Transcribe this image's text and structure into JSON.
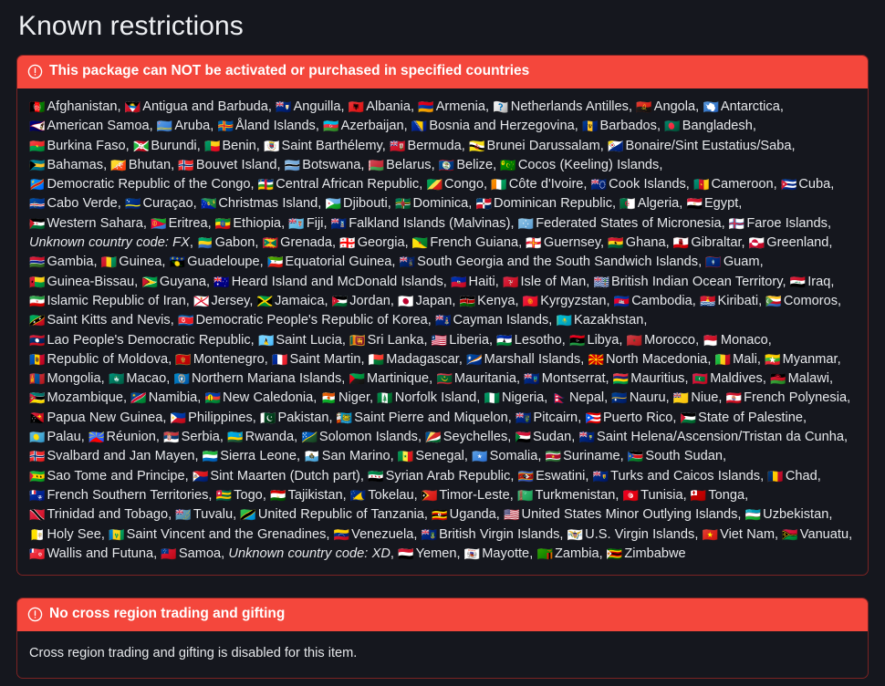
{
  "page": {
    "title": "Known restrictions",
    "background_color": "#15171e",
    "accent_color": "#f4473c",
    "border_color": "#7b2323",
    "text_color": "#e6e8eb"
  },
  "panels": [
    {
      "id": "country-restrictions",
      "icon": "exclamation-circle-icon",
      "header": "This package can NOT be activated or purchased in specified countries",
      "separator": ", ",
      "countries": [
        {
          "flag": "🇦🇫",
          "name": "Afghanistan"
        },
        {
          "flag": "🇦🇬",
          "name": "Antigua and Barbuda"
        },
        {
          "flag": "🇦🇮",
          "name": "Anguilla"
        },
        {
          "flag": "🇦🇱",
          "name": "Albania"
        },
        {
          "flag": "🇦🇲",
          "name": "Armenia"
        },
        {
          "flag": "🇦🇳",
          "name": "Netherlands Antilles"
        },
        {
          "flag": "🇦🇴",
          "name": "Angola"
        },
        {
          "flag": "🇦🇶",
          "name": "Antarctica"
        },
        {
          "flag": "🇦🇸",
          "name": "American Samoa"
        },
        {
          "flag": "🇦🇼",
          "name": "Aruba"
        },
        {
          "flag": "🇦🇽",
          "name": "Åland Islands"
        },
        {
          "flag": "🇦🇿",
          "name": "Azerbaijan"
        },
        {
          "flag": "🇧🇦",
          "name": "Bosnia and Herzegovina"
        },
        {
          "flag": "🇧🇧",
          "name": "Barbados"
        },
        {
          "flag": "🇧🇩",
          "name": "Bangladesh"
        },
        {
          "flag": "🇧🇫",
          "name": "Burkina Faso"
        },
        {
          "flag": "🇧🇮",
          "name": "Burundi"
        },
        {
          "flag": "🇧🇯",
          "name": "Benin"
        },
        {
          "flag": "🇧🇱",
          "name": "Saint Barthélemy"
        },
        {
          "flag": "🇧🇲",
          "name": "Bermuda"
        },
        {
          "flag": "🇧🇳",
          "name": "Brunei Darussalam"
        },
        {
          "flag": "🇧🇶",
          "name": "Bonaire/Sint Eustatius/Saba"
        },
        {
          "flag": "🇧🇸",
          "name": "Bahamas"
        },
        {
          "flag": "🇧🇹",
          "name": "Bhutan"
        },
        {
          "flag": "🇧🇻",
          "name": "Bouvet Island"
        },
        {
          "flag": "🇧🇼",
          "name": "Botswana"
        },
        {
          "flag": "🇧🇾",
          "name": "Belarus"
        },
        {
          "flag": "🇧🇿",
          "name": "Belize"
        },
        {
          "flag": "🇨🇨",
          "name": "Cocos (Keeling) Islands"
        },
        {
          "flag": "🇨🇩",
          "name": "Democratic Republic of the Congo"
        },
        {
          "flag": "🇨🇫",
          "name": "Central African Republic"
        },
        {
          "flag": "🇨🇬",
          "name": "Congo"
        },
        {
          "flag": "🇨🇮",
          "name": "Côte d'Ivoire"
        },
        {
          "flag": "🇨🇰",
          "name": "Cook Islands"
        },
        {
          "flag": "🇨🇲",
          "name": "Cameroon"
        },
        {
          "flag": "🇨🇺",
          "name": "Cuba"
        },
        {
          "flag": "🇨🇻",
          "name": "Cabo Verde"
        },
        {
          "flag": "🇨🇼",
          "name": "Curaçao"
        },
        {
          "flag": "🇨🇽",
          "name": "Christmas Island"
        },
        {
          "flag": "🇩🇯",
          "name": "Djibouti"
        },
        {
          "flag": "🇩🇲",
          "name": "Dominica"
        },
        {
          "flag": "🇩🇴",
          "name": "Dominican Republic"
        },
        {
          "flag": "🇩🇿",
          "name": "Algeria"
        },
        {
          "flag": "🇪🇬",
          "name": "Egypt"
        },
        {
          "flag": "🇪🇭",
          "name": "Western Sahara"
        },
        {
          "flag": "🇪🇷",
          "name": "Eritrea"
        },
        {
          "flag": "🇪🇹",
          "name": "Ethiopia"
        },
        {
          "flag": "🇫🇯",
          "name": "Fiji"
        },
        {
          "flag": "🇫🇰",
          "name": "Falkland Islands (Malvinas)"
        },
        {
          "flag": "🇫🇲",
          "name": "Federated States of Micronesia"
        },
        {
          "flag": "🇫🇴",
          "name": "Faroe Islands"
        },
        {
          "flag": "",
          "name": "Unknown country code: FX",
          "unknown": true
        },
        {
          "flag": "🇬🇦",
          "name": "Gabon"
        },
        {
          "flag": "🇬🇩",
          "name": "Grenada"
        },
        {
          "flag": "🇬🇪",
          "name": "Georgia"
        },
        {
          "flag": "🇬🇫",
          "name": "French Guiana"
        },
        {
          "flag": "🇬🇬",
          "name": "Guernsey"
        },
        {
          "flag": "🇬🇭",
          "name": "Ghana"
        },
        {
          "flag": "🇬🇮",
          "name": "Gibraltar"
        },
        {
          "flag": "🇬🇱",
          "name": "Greenland"
        },
        {
          "flag": "🇬🇲",
          "name": "Gambia"
        },
        {
          "flag": "🇬🇳",
          "name": "Guinea"
        },
        {
          "flag": "🇬🇵",
          "name": "Guadeloupe"
        },
        {
          "flag": "🇬🇶",
          "name": "Equatorial Guinea"
        },
        {
          "flag": "🇬🇸",
          "name": "South Georgia and the South Sandwich Islands"
        },
        {
          "flag": "🇬🇺",
          "name": "Guam"
        },
        {
          "flag": "🇬🇼",
          "name": "Guinea-Bissau"
        },
        {
          "flag": "🇬🇾",
          "name": "Guyana"
        },
        {
          "flag": "🇭🇲",
          "name": "Heard Island and McDonald Islands"
        },
        {
          "flag": "🇭🇹",
          "name": "Haiti"
        },
        {
          "flag": "🇮🇲",
          "name": "Isle of Man"
        },
        {
          "flag": "🇮🇴",
          "name": "British Indian Ocean Territory"
        },
        {
          "flag": "🇮🇶",
          "name": "Iraq"
        },
        {
          "flag": "🇮🇷",
          "name": "Islamic Republic of Iran"
        },
        {
          "flag": "🇯🇪",
          "name": "Jersey"
        },
        {
          "flag": "🇯🇲",
          "name": "Jamaica"
        },
        {
          "flag": "🇯🇴",
          "name": "Jordan"
        },
        {
          "flag": "🇯🇵",
          "name": "Japan"
        },
        {
          "flag": "🇰🇪",
          "name": "Kenya"
        },
        {
          "flag": "🇰🇬",
          "name": "Kyrgyzstan"
        },
        {
          "flag": "🇰🇭",
          "name": "Cambodia"
        },
        {
          "flag": "🇰🇮",
          "name": "Kiribati"
        },
        {
          "flag": "🇰🇲",
          "name": "Comoros"
        },
        {
          "flag": "🇰🇳",
          "name": "Saint Kitts and Nevis"
        },
        {
          "flag": "🇰🇵",
          "name": "Democratic People's Republic of Korea"
        },
        {
          "flag": "🇰🇾",
          "name": "Cayman Islands"
        },
        {
          "flag": "🇰🇿",
          "name": "Kazakhstan"
        },
        {
          "flag": "🇱🇦",
          "name": "Lao People's Democratic Republic"
        },
        {
          "flag": "🇱🇨",
          "name": "Saint Lucia"
        },
        {
          "flag": "🇱🇰",
          "name": "Sri Lanka"
        },
        {
          "flag": "🇱🇷",
          "name": "Liberia"
        },
        {
          "flag": "🇱🇸",
          "name": "Lesotho"
        },
        {
          "flag": "🇱🇾",
          "name": "Libya"
        },
        {
          "flag": "🇲🇦",
          "name": "Morocco"
        },
        {
          "flag": "🇲🇨",
          "name": "Monaco"
        },
        {
          "flag": "🇲🇩",
          "name": "Republic of Moldova"
        },
        {
          "flag": "🇲🇪",
          "name": "Montenegro"
        },
        {
          "flag": "🇲🇫",
          "name": "Saint Martin"
        },
        {
          "flag": "🇲🇬",
          "name": "Madagascar"
        },
        {
          "flag": "🇲🇭",
          "name": "Marshall Islands"
        },
        {
          "flag": "🇲🇰",
          "name": "North Macedonia"
        },
        {
          "flag": "🇲🇱",
          "name": "Mali"
        },
        {
          "flag": "🇲🇲",
          "name": "Myanmar"
        },
        {
          "flag": "🇲🇳",
          "name": "Mongolia"
        },
        {
          "flag": "🇲🇴",
          "name": "Macao"
        },
        {
          "flag": "🇲🇵",
          "name": "Northern Mariana Islands"
        },
        {
          "flag": "🇲🇶",
          "name": "Martinique"
        },
        {
          "flag": "🇲🇷",
          "name": "Mauritania"
        },
        {
          "flag": "🇲🇸",
          "name": "Montserrat"
        },
        {
          "flag": "🇲🇺",
          "name": "Mauritius"
        },
        {
          "flag": "🇲🇻",
          "name": "Maldives"
        },
        {
          "flag": "🇲🇼",
          "name": "Malawi"
        },
        {
          "flag": "🇲🇿",
          "name": "Mozambique"
        },
        {
          "flag": "🇳🇦",
          "name": "Namibia"
        },
        {
          "flag": "🇳🇨",
          "name": "New Caledonia"
        },
        {
          "flag": "🇳🇪",
          "name": "Niger"
        },
        {
          "flag": "🇳🇫",
          "name": "Norfolk Island"
        },
        {
          "flag": "🇳🇬",
          "name": "Nigeria"
        },
        {
          "flag": "🇳🇵",
          "name": "Nepal"
        },
        {
          "flag": "🇳🇷",
          "name": "Nauru"
        },
        {
          "flag": "🇳🇺",
          "name": "Niue"
        },
        {
          "flag": "🇵🇫",
          "name": "French Polynesia"
        },
        {
          "flag": "🇵🇬",
          "name": "Papua New Guinea"
        },
        {
          "flag": "🇵🇭",
          "name": "Philippines"
        },
        {
          "flag": "🇵🇰",
          "name": "Pakistan"
        },
        {
          "flag": "🇵🇲",
          "name": "Saint Pierre and Miquelon"
        },
        {
          "flag": "🇵🇳",
          "name": "Pitcairn"
        },
        {
          "flag": "🇵🇷",
          "name": "Puerto Rico"
        },
        {
          "flag": "🇵🇸",
          "name": "State of Palestine"
        },
        {
          "flag": "🇵🇼",
          "name": "Palau"
        },
        {
          "flag": "🇷🇪",
          "name": "Réunion"
        },
        {
          "flag": "🇷🇸",
          "name": "Serbia"
        },
        {
          "flag": "🇷🇼",
          "name": "Rwanda"
        },
        {
          "flag": "🇸🇧",
          "name": "Solomon Islands"
        },
        {
          "flag": "🇸🇨",
          "name": "Seychelles"
        },
        {
          "flag": "🇸🇩",
          "name": "Sudan"
        },
        {
          "flag": "🇸🇭",
          "name": "Saint Helena/Ascension/Tristan da Cunha"
        },
        {
          "flag": "🇸🇯",
          "name": "Svalbard and Jan Mayen"
        },
        {
          "flag": "🇸🇱",
          "name": "Sierra Leone"
        },
        {
          "flag": "🇸🇲",
          "name": "San Marino"
        },
        {
          "flag": "🇸🇳",
          "name": "Senegal"
        },
        {
          "flag": "🇸🇴",
          "name": "Somalia"
        },
        {
          "flag": "🇸🇷",
          "name": "Suriname"
        },
        {
          "flag": "🇸🇸",
          "name": "South Sudan"
        },
        {
          "flag": "🇸🇹",
          "name": "Sao Tome and Principe"
        },
        {
          "flag": "🇸🇽",
          "name": "Sint Maarten (Dutch part)"
        },
        {
          "flag": "🇸🇾",
          "name": "Syrian Arab Republic"
        },
        {
          "flag": "🇸🇿",
          "name": "Eswatini"
        },
        {
          "flag": "🇹🇨",
          "name": "Turks and Caicos Islands"
        },
        {
          "flag": "🇹🇩",
          "name": "Chad"
        },
        {
          "flag": "🇹🇫",
          "name": "French Southern Territories"
        },
        {
          "flag": "🇹🇬",
          "name": "Togo"
        },
        {
          "flag": "🇹🇯",
          "name": "Tajikistan"
        },
        {
          "flag": "🇹🇰",
          "name": "Tokelau"
        },
        {
          "flag": "🇹🇱",
          "name": "Timor-Leste"
        },
        {
          "flag": "🇹🇲",
          "name": "Turkmenistan"
        },
        {
          "flag": "🇹🇳",
          "name": "Tunisia"
        },
        {
          "flag": "🇹🇴",
          "name": "Tonga"
        },
        {
          "flag": "🇹🇹",
          "name": "Trinidad and Tobago"
        },
        {
          "flag": "🇹🇻",
          "name": "Tuvalu"
        },
        {
          "flag": "🇹🇿",
          "name": "United Republic of Tanzania"
        },
        {
          "flag": "🇺🇬",
          "name": "Uganda"
        },
        {
          "flag": "🇺🇲",
          "name": "United States Minor Outlying Islands"
        },
        {
          "flag": "🇺🇿",
          "name": "Uzbekistan"
        },
        {
          "flag": "🇻🇦",
          "name": "Holy See"
        },
        {
          "flag": "🇻🇨",
          "name": "Saint Vincent and the Grenadines"
        },
        {
          "flag": "🇻🇪",
          "name": "Venezuela"
        },
        {
          "flag": "🇻🇬",
          "name": "British Virgin Islands"
        },
        {
          "flag": "🇻🇮",
          "name": "U.S. Virgin Islands"
        },
        {
          "flag": "🇻🇳",
          "name": "Viet Nam"
        },
        {
          "flag": "🇻🇺",
          "name": "Vanuatu"
        },
        {
          "flag": "🇼🇫",
          "name": "Wallis and Futuna"
        },
        {
          "flag": "🇼🇸",
          "name": "Samoa"
        },
        {
          "flag": "",
          "name": "Unknown country code: XD",
          "unknown": true
        },
        {
          "flag": "🇾🇪",
          "name": "Yemen"
        },
        {
          "flag": "🇾🇹",
          "name": "Mayotte"
        },
        {
          "flag": "🇿🇲",
          "name": "Zambia"
        },
        {
          "flag": "🇿🇼",
          "name": "Zimbabwe"
        }
      ]
    },
    {
      "id": "cross-region-trading",
      "icon": "exclamation-circle-icon",
      "header": "No cross region trading and gifting",
      "body_text": "Cross region trading and gifting is disabled for this item."
    }
  ]
}
